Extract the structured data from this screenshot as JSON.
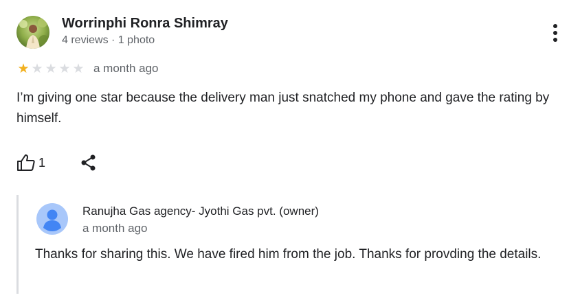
{
  "review": {
    "reviewer_name": "Worrinphi Ronra Shimray",
    "reviewer_meta": "4 reviews · 1 photo",
    "rating": 1,
    "max_rating": 5,
    "time": "a month ago",
    "text": "I’m giving one star because the delivery man just snatched my phone and gave the rating by himself.",
    "like_count": "1",
    "icons": {
      "avatar": "user-photo",
      "more": "more-vert-icon",
      "like": "thumbs-up-icon",
      "share": "share-icon",
      "star_filled": "star-filled-icon",
      "star_empty": "star-empty-icon"
    }
  },
  "owner_reply": {
    "name": "Ranujha Gas agency- Jyothi Gas pvt. (owner)",
    "time": "a month ago",
    "text": "Thanks for sharing this. We have fired him from the job. Thanks for provding the details.",
    "avatar_icon": "person-avatar-icon"
  },
  "colors": {
    "star_filled": "#f2b01e",
    "star_empty": "#dadce0",
    "owner_avatar_bg": "#a8c7fa",
    "owner_avatar_fg": "#4285f4",
    "reply_border": "#dadce0"
  }
}
